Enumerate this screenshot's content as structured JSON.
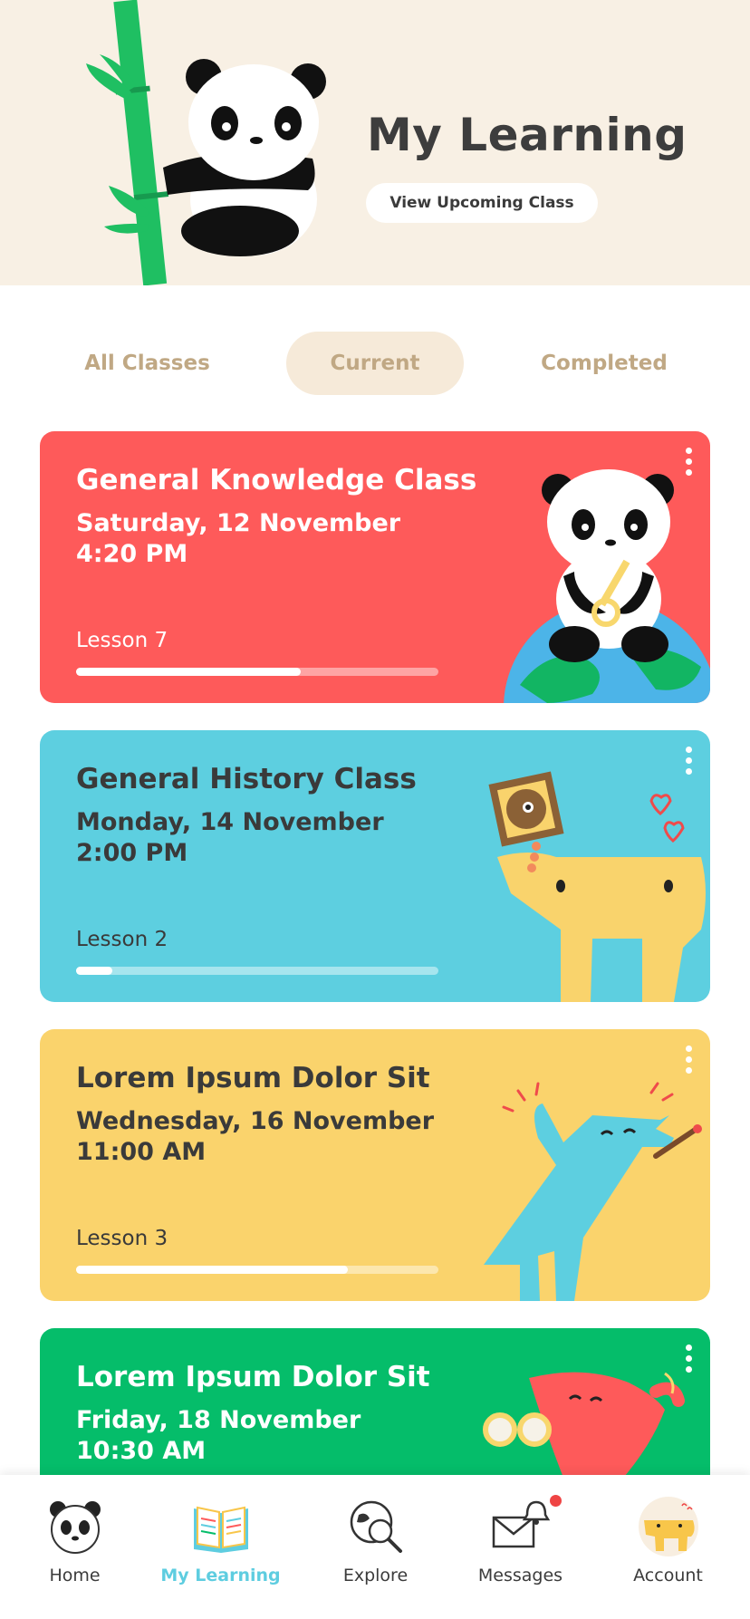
{
  "header": {
    "title": "My Learning",
    "upcoming_button": "View Upcoming Class"
  },
  "tabs": [
    {
      "label": "All Classes",
      "active": false
    },
    {
      "label": "Current",
      "active": true
    },
    {
      "label": "Completed",
      "active": false
    }
  ],
  "classes": [
    {
      "title": "General Knowledge Class",
      "date": "Saturday, 12 November",
      "time": "4:20 PM",
      "lesson": "Lesson 7",
      "progress": 0.62,
      "color": "#fe5a5a",
      "illustration": "panda-on-globe-illustration"
    },
    {
      "title": "General History Class",
      "date": "Monday, 14 November",
      "time": "2:00 PM",
      "lesson": "Lesson 2",
      "progress": 0.1,
      "color": "#5dcfe0",
      "illustration": "yellow-creature-illustration"
    },
    {
      "title": "Lorem Ipsum Dolor Sit",
      "date": "Wednesday, 16 November",
      "time": "11:00 AM",
      "lesson": "Lesson 3",
      "progress": 0.75,
      "color": "#fad36c",
      "illustration": "blue-painter-creature-illustration"
    },
    {
      "title": "Lorem Ipsum Dolor Sit",
      "date": "Friday, 18 November",
      "time": "10:30 AM",
      "lesson": "",
      "progress": 0,
      "color": "#05bd6a",
      "illustration": "red-creature-binoculars-illustration"
    }
  ],
  "nav": [
    {
      "label": "Home",
      "icon": "panda-face-icon",
      "active": false
    },
    {
      "label": "My Learning",
      "icon": "open-book-icon",
      "active": true
    },
    {
      "label": "Explore",
      "icon": "globe-search-icon",
      "active": false
    },
    {
      "label": "Messages",
      "icon": "envelope-bell-icon",
      "active": false,
      "badge": true
    },
    {
      "label": "Account",
      "icon": "avatar-icon",
      "active": false
    }
  ],
  "colors": {
    "accent": "#5ecde0",
    "header_bg": "#f8f0e4",
    "tab_text": "#c0a884",
    "notification": "#ef4444"
  }
}
